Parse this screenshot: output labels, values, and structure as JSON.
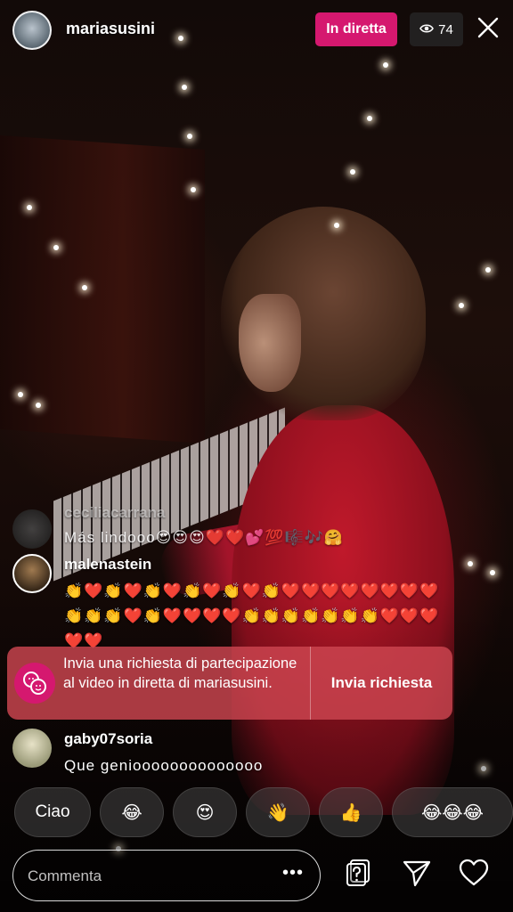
{
  "header": {
    "username": "mariasusini",
    "live_label": "In diretta",
    "viewer_count": "74"
  },
  "comments": [
    {
      "username": "ceciliacarrana",
      "text": "Más lindooo😍😍😍❤️❤️💕💯🎼🎶🤗"
    },
    {
      "username": "malenastein",
      "text": "👏❤️👏❤️👏❤️👏❤️👏❤️👏❤️❤️❤️❤️❤️❤️❤️❤️👏👏👏❤️👏❤️❤️❤️❤️👏👏👏👏👏👏👏❤️❤️❤️❤️❤️"
    },
    {
      "username": "gaby07soria",
      "text": "Que genioooooooooooooo"
    }
  ],
  "request_card": {
    "message": "Invia una richiesta di partecipazione al video in diretta di mariasusini.",
    "button_label": "Invia richiesta"
  },
  "quick_replies": [
    "Ciao",
    "😂",
    "😍",
    "👋",
    "👍",
    "😂😂😂"
  ],
  "composer": {
    "placeholder": "Commenta",
    "more_label": "•••"
  },
  "colors": {
    "live_badge": "#d5186f",
    "request_card": "#cd4650"
  },
  "icons": [
    "close-icon",
    "eye-icon",
    "question-box-icon",
    "send-icon",
    "heart-icon",
    "request-icon"
  ]
}
